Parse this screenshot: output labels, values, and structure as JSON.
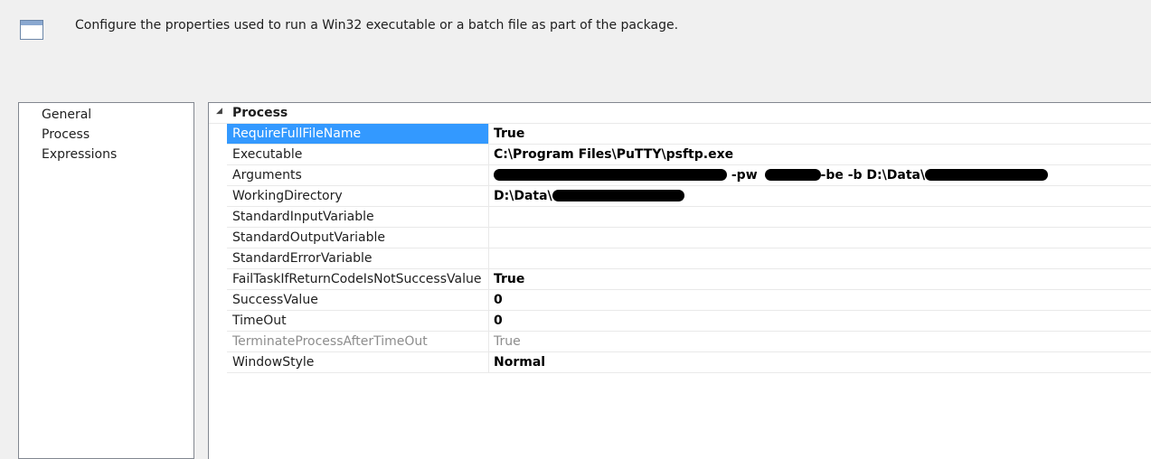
{
  "header": {
    "description": "Configure the properties used to run a Win32 executable or a batch file as part of the package.",
    "icon": "window-icon"
  },
  "nav": {
    "items": [
      {
        "label": "General"
      },
      {
        "label": "Process"
      },
      {
        "label": "Expressions"
      }
    ],
    "selected": "Process"
  },
  "grid": {
    "category": {
      "title": "Process",
      "toggle": "◢"
    },
    "properties": [
      {
        "name": "RequireFullFileName",
        "value": "True"
      },
      {
        "name": "Executable",
        "value": "C:\\Program Files\\PuTTY\\psftp.exe"
      },
      {
        "name": "Arguments",
        "value_parts": [
          "-pw",
          "-be -b D:\\Data\\"
        ]
      },
      {
        "name": "WorkingDirectory",
        "value": "D:\\Data\\"
      },
      {
        "name": "StandardInputVariable",
        "value": ""
      },
      {
        "name": "StandardOutputVariable",
        "value": ""
      },
      {
        "name": "StandardErrorVariable",
        "value": ""
      },
      {
        "name": "FailTaskIfReturnCodeIsNotSuccessValue",
        "value": "True"
      },
      {
        "name": "SuccessValue",
        "value": "0"
      },
      {
        "name": "TimeOut",
        "value": "0"
      },
      {
        "name": "TerminateProcessAfterTimeOut",
        "value": "True"
      },
      {
        "name": "WindowStyle",
        "value": "Normal"
      }
    ]
  },
  "colors": {
    "selection": "#3399ff",
    "disabled_text": "#8d8d8d",
    "grid_line": "#e9e9e9"
  }
}
